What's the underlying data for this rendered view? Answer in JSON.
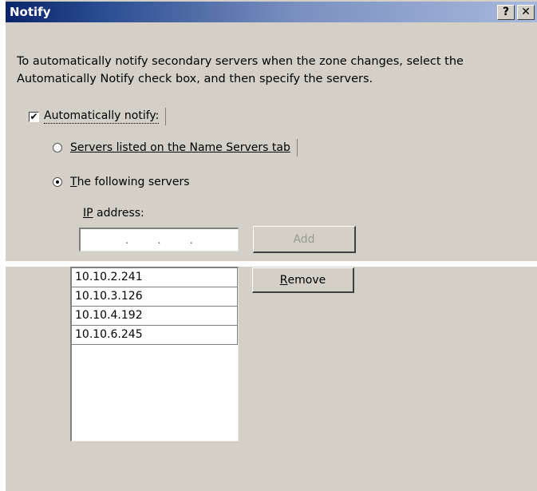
{
  "window": {
    "title": "Notify",
    "help_button": "?",
    "close_button": "✕"
  },
  "description": "To automatically notify secondary servers when the zone changes, select the Automatically Notify check box, and then specify the servers.",
  "auto_notify": {
    "label": "Automatically notify:",
    "checked": true,
    "check_mark": "✔"
  },
  "radio_options": {
    "name_servers": {
      "label": "Servers listed on the Name Servers tab",
      "selected": false
    },
    "following": {
      "label_accel": "T",
      "label_rest": "he following servers",
      "selected": true
    }
  },
  "ip_address": {
    "label_accel": "IP",
    "label_rest": " address:",
    "dots": [
      ".",
      ".",
      "."
    ]
  },
  "buttons": {
    "add": {
      "label": "Add",
      "enabled": false
    },
    "remove": {
      "label_accel": "R",
      "label_rest": "emove"
    }
  },
  "servers": [
    "10.10.2.241",
    "10.10.3.126",
    "10.10.4.192",
    "10.10.6.245"
  ]
}
